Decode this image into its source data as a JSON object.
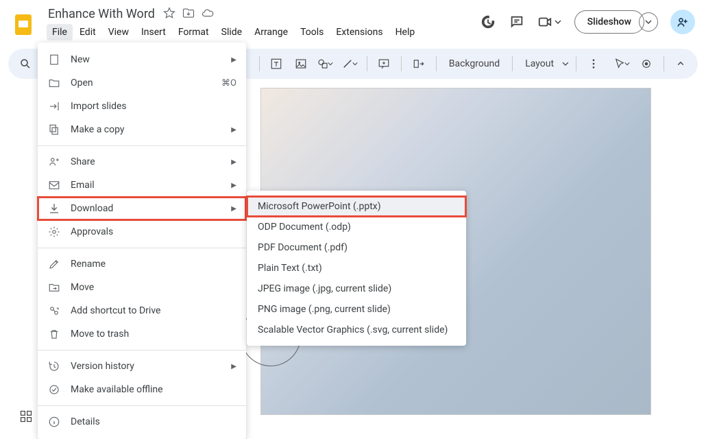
{
  "document": {
    "title": "Enhance With Word"
  },
  "menu": {
    "items": [
      "File",
      "Edit",
      "View",
      "Insert",
      "Format",
      "Slide",
      "Arrange",
      "Tools",
      "Extensions",
      "Help"
    ],
    "active": "File"
  },
  "slideshow": {
    "label": "Slideshow"
  },
  "toolbar": {
    "background_label": "Background",
    "layout_label": "Layout"
  },
  "file_menu": {
    "items": [
      {
        "label": "New",
        "icon": "doc",
        "arrow": true
      },
      {
        "label": "Open",
        "icon": "folder",
        "shortcut": "⌘O"
      },
      {
        "label": "Import slides",
        "icon": "import"
      },
      {
        "label": "Make a copy",
        "icon": "copy",
        "arrow": true
      },
      {
        "divider": true
      },
      {
        "label": "Share",
        "icon": "share",
        "arrow": true
      },
      {
        "label": "Email",
        "icon": "email",
        "arrow": true
      },
      {
        "label": "Download",
        "icon": "download",
        "arrow": true,
        "highlighted": true
      },
      {
        "label": "Approvals",
        "icon": "approvals"
      },
      {
        "divider": true
      },
      {
        "label": "Rename",
        "icon": "rename"
      },
      {
        "label": "Move",
        "icon": "move"
      },
      {
        "label": "Add shortcut to Drive",
        "icon": "shortcut"
      },
      {
        "label": "Move to trash",
        "icon": "trash"
      },
      {
        "divider": true
      },
      {
        "label": "Version history",
        "icon": "history",
        "arrow": true
      },
      {
        "label": "Make available offline",
        "icon": "offline"
      },
      {
        "divider": true
      },
      {
        "label": "Details",
        "icon": "details"
      }
    ]
  },
  "download_submenu": {
    "items": [
      {
        "label": "Microsoft PowerPoint (.pptx)",
        "highlighted": true
      },
      {
        "label": "ODP Document (.odp)"
      },
      {
        "label": "PDF Document (.pdf)"
      },
      {
        "label": "Plain Text (.txt)"
      },
      {
        "label": "JPEG image (.jpg, current slide)"
      },
      {
        "label": "PNG image (.png, current slide)"
      },
      {
        "label": "Scalable Vector Graphics (.svg, current slide)"
      }
    ]
  }
}
